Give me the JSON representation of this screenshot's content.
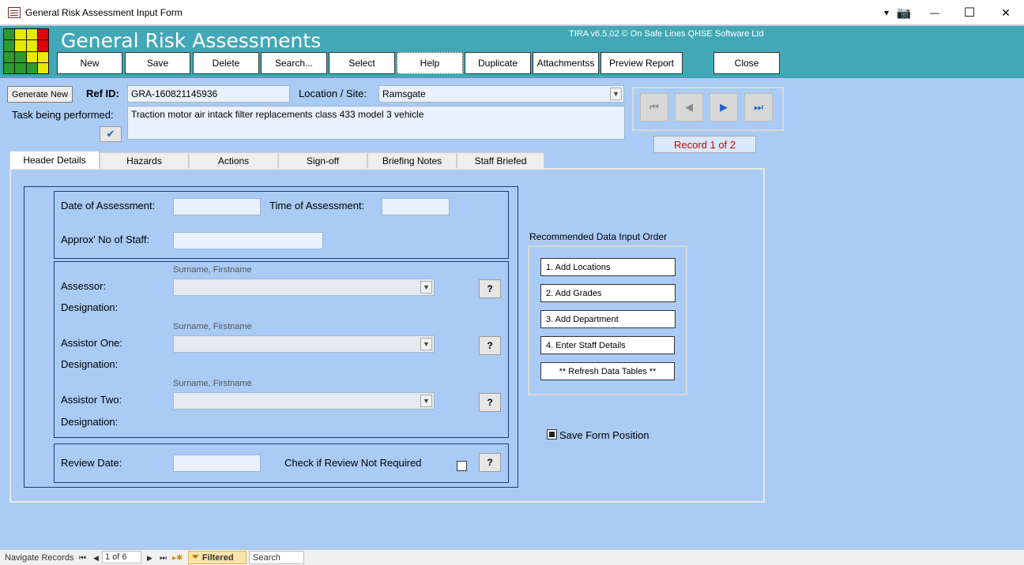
{
  "window": {
    "title": "General Risk Assessment Input Form",
    "controls": {
      "dropdown": "▾",
      "camera": "📷",
      "minimize": "—",
      "maximize": "☐",
      "close": "✕"
    }
  },
  "banner": {
    "title": "General Risk Assessments",
    "version": "TIRA v6.5.02 © On Safe Lines QHSE Software Ltd",
    "logo_colors": [
      "#2d9b2d",
      "#e8e800",
      "#e8e800",
      "#e00000",
      "#2d9b2d",
      "#e8e800",
      "#e8e800",
      "#e00000",
      "#2d9b2d",
      "#2d9b2d",
      "#e8e800",
      "#e8e800",
      "#2d9b2d",
      "#2d9b2d",
      "#2d9b2d",
      "#e8e800"
    ]
  },
  "toolbar": {
    "new": "New",
    "save": "Save",
    "delete": "Delete",
    "search": "Search...",
    "select": "Select",
    "help": "Help",
    "duplicate": "Duplicate",
    "attachments": "Attachmentss",
    "preview_report": "Preview Report",
    "close": "Close"
  },
  "header": {
    "generate_new": "Generate New",
    "ref_id_label": "Ref ID:",
    "ref_id_value": "GRA-160821145936",
    "location_label": "Location / Site:",
    "location_value": "Ramsgate",
    "task_label": "Task being performed:",
    "task_value": "Traction motor air intack filter replacements class 433 model 3 vehicle"
  },
  "navigator": {
    "first": "⏮",
    "prev": "◀",
    "next": "▶",
    "last": "⏭",
    "record_label": "Record 1 of 2"
  },
  "tabs": [
    "Header Details",
    "Hazards",
    "Actions",
    "Sign-off",
    "Briefing Notes",
    "Staff Briefed"
  ],
  "details": {
    "date_label": "Date of Assessment:",
    "time_label": "Time of Assessment:",
    "staff_label": "Approx' No of Staff:",
    "hint": "Surname, Firstname",
    "assessor_label": "Assessor:",
    "assistor_one_label": "Assistor One:",
    "assistor_two_label": "Assistor Two:",
    "designation_label": "Designation:",
    "review_label": "Review Date:",
    "review_check_label": "Check if Review Not Required",
    "help_btn": "?"
  },
  "recommended": {
    "title": "Recommended Data Input Order",
    "items": [
      "1. Add Locations",
      "2. Add Grades",
      "3. Add Department",
      "4. Enter Staff Details",
      "** Refresh Data Tables **"
    ]
  },
  "save_form_position": "Save Form Position",
  "statusbar": {
    "navigate_label": "Navigate Records",
    "record_value": "1 of 6",
    "filtered": "Filtered",
    "search": "Search"
  }
}
